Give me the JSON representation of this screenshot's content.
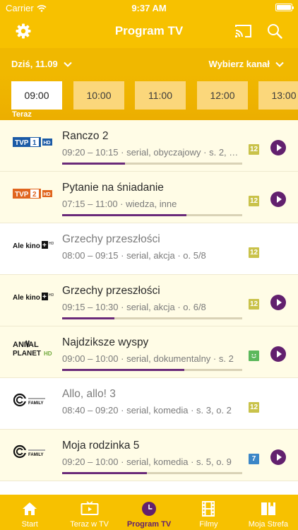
{
  "status": {
    "carrier": "Carrier",
    "time": "9:37 AM",
    "battery_level": 1.0
  },
  "header": {
    "title": "Program TV",
    "left_icon": "gear-icon",
    "right_icons": [
      "cast-icon",
      "search-icon"
    ]
  },
  "datebar": {
    "date": "Dziś, 11.09",
    "channel": "Wybierz kanał"
  },
  "hours": {
    "items": [
      "09:00",
      "10:00",
      "11:00",
      "12:00",
      "13:00"
    ],
    "selected": "09:00",
    "now_label": "Teraz"
  },
  "programs": [
    {
      "channel": "TVP1 HD",
      "title": "Ranczo 2",
      "meta": "09:20 – 10:15 · serial, obyczajowy · s. 2, o...",
      "age": "12",
      "progress": 0.35,
      "state": "live"
    },
    {
      "channel": "TVP2 HD",
      "title": "Pytanie na śniadanie",
      "meta": "07:15 – 11:00 · wiedza, inne",
      "age": "12",
      "progress": 0.69,
      "state": "live"
    },
    {
      "channel": "Ale kino+ HD",
      "title": "Grzechy przeszłości",
      "meta": "08:00 – 09:15 · serial, akcja · o. 5/8",
      "age": "12",
      "progress": null,
      "state": "past"
    },
    {
      "channel": "Ale kino+ HD",
      "title": "Grzechy przeszłości",
      "meta": "09:15 – 10:30 · serial, akcja · o. 6/8",
      "age": "12",
      "progress": 0.29,
      "state": "live"
    },
    {
      "channel": "Animal Planet HD",
      "title": "Najdziksze wyspy",
      "meta": "09:00 – 10:00 · serial, dokumentalny · s. 2",
      "age": "face",
      "progress": 0.68,
      "state": "live"
    },
    {
      "channel": "Comedy Central Family",
      "title": "Allo, allo! 3",
      "meta": "08:40 – 09:20 · serial, komedia · s. 3, o. 2",
      "age": "12",
      "progress": null,
      "state": "past"
    },
    {
      "channel": "Comedy Central Family",
      "title": "Moja rodzinka 5",
      "meta": "09:20 – 10:00 · serial, komedia · s. 5, o. 9",
      "age": "7",
      "progress": 0.47,
      "state": "live"
    }
  ],
  "age_colors": {
    "12": "#c9c24a",
    "7": "#3b86c7",
    "face": "#5cb85c"
  },
  "tabs": [
    {
      "label": "Start",
      "icon": "home-icon"
    },
    {
      "label": "Teraz w TV",
      "icon": "tv-icon"
    },
    {
      "label": "Program TV",
      "icon": "clock-icon",
      "active": true
    },
    {
      "label": "Filmy",
      "icon": "film-icon"
    },
    {
      "label": "Moja Strefa",
      "icon": "book-icon"
    }
  ],
  "colors": {
    "accent": "#f7c100",
    "purple": "#62206e"
  }
}
